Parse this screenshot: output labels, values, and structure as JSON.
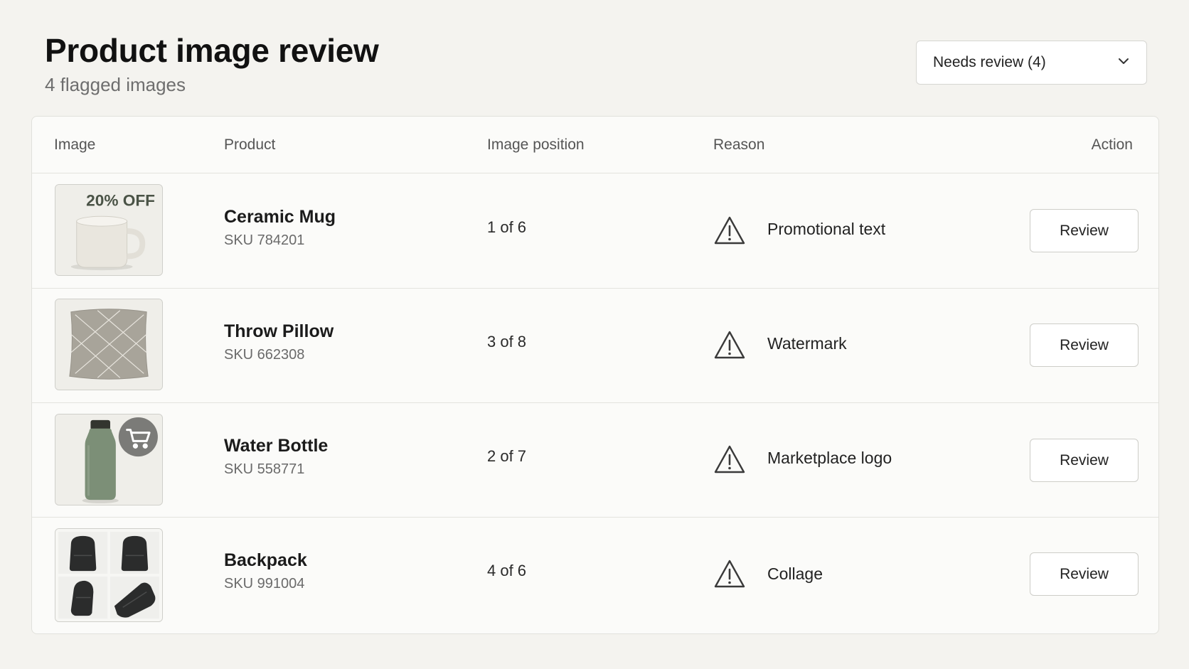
{
  "header": {
    "title": "Product image review",
    "subtitle": "4 flagged images",
    "filter_value": "Needs review (4)"
  },
  "table": {
    "columns": {
      "image": "Image",
      "product": "Product",
      "position": "Image position",
      "reason": "Reason",
      "action": "Action"
    },
    "rows": [
      {
        "name": "Ceramic Mug",
        "sku": "SKU 784201",
        "position": "1 of 6",
        "reason": "Promotional text",
        "action": "Review",
        "thumb_text": "20% OFF"
      },
      {
        "name": "Throw Pillow",
        "sku": "SKU 662308",
        "position": "3 of 8",
        "reason": "Watermark",
        "action": "Review"
      },
      {
        "name": "Water Bottle",
        "sku": "SKU 558771",
        "position": "2 of 7",
        "reason": "Marketplace logo",
        "action": "Review"
      },
      {
        "name": "Backpack",
        "sku": "SKU 991004",
        "position": "4 of 6",
        "reason": "Collage",
        "action": "Review"
      }
    ]
  },
  "icons": {
    "filter": "chevron-down-icon",
    "reason": "warning-triangle-icon",
    "bottle_overlay": "cart-icon"
  }
}
